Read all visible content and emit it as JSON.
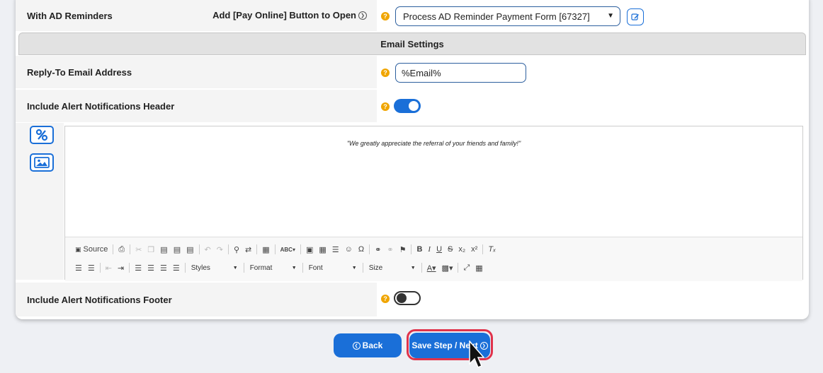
{
  "row1": {
    "label": "With AD Reminders",
    "right_label": "Add [Pay Online] Button to Open",
    "select_value": "Process AD Reminder Payment Form [67327]"
  },
  "section": {
    "title": "Email Settings"
  },
  "reply_to": {
    "label": "Reply-To Email Address",
    "value": "%Email%"
  },
  "alert_header": {
    "label": "Include Alert Notifications Header",
    "enabled": true
  },
  "alert_footer": {
    "label": "Include Alert Notifications Footer",
    "enabled": false
  },
  "editor": {
    "content": "\"We greatly appreciate the referral of your friends and family!\"",
    "toolbar": {
      "source_label": "Source",
      "styles_label": "Styles",
      "format_label": "Format",
      "font_label": "Font",
      "size_label": "Size"
    }
  },
  "buttons": {
    "back_label": "Back",
    "next_label": "Save Step / Next"
  },
  "colors": {
    "primary": "#1a6fd8",
    "help": "#f0a500",
    "highlight": "#e0334b"
  }
}
